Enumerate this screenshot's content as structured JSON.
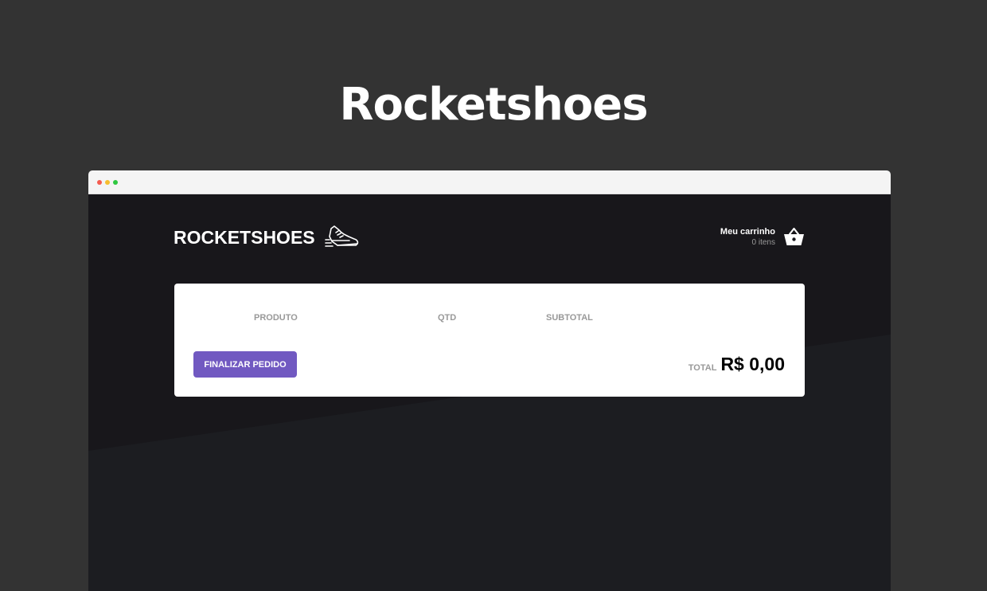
{
  "page": {
    "title": "Rocketshoes"
  },
  "header": {
    "logo_text": "ROCKETSHOES",
    "cart_title": "Meu carrinho",
    "cart_count": "0 itens"
  },
  "cart_table": {
    "columns": [
      "PRODUTO",
      "QTD",
      "SUBTOTAL"
    ],
    "finish_button_label": "FINALIZAR PEDIDO",
    "total_label": "TOTAL",
    "total_value": "R$ 0,00"
  },
  "icons": {
    "logo": "running-shoe-icon",
    "cart": "shopping-basket-icon"
  },
  "colors": {
    "background": "#333333",
    "app_background": "#191920",
    "accent": "#7159c1",
    "card": "#ffffff"
  }
}
